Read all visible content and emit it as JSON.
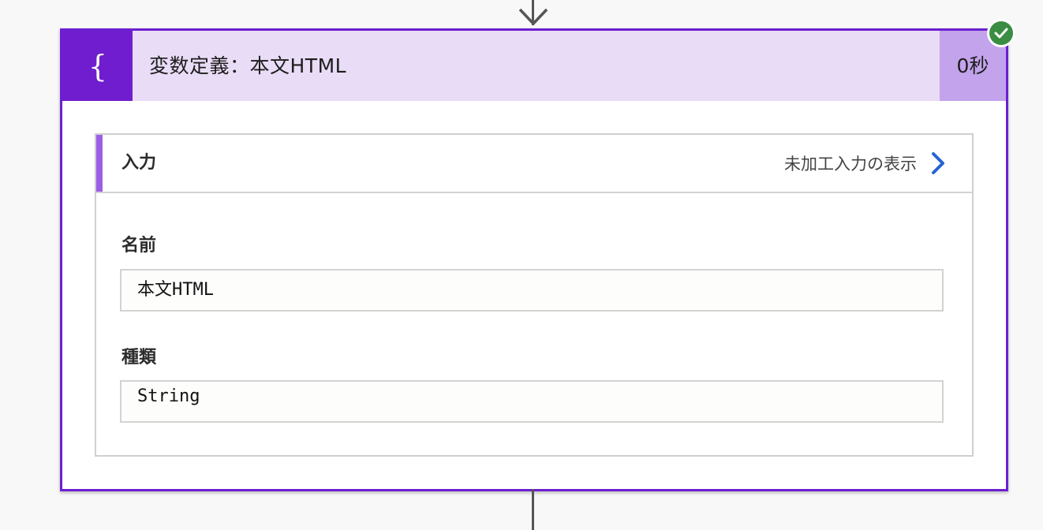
{
  "action": {
    "title": "変数定義：本文HTML",
    "duration": "0秒",
    "icon": "variable-braces-icon",
    "status": "succeeded",
    "colors": {
      "accent": "#6f1dce",
      "header_bg": "#e9dcf6",
      "duration_bg": "#c3a3ec",
      "success": "#3a8d42"
    }
  },
  "inputs": {
    "title": "入力",
    "raw_link_label": "未加工入力の表示",
    "fields": [
      {
        "label": "名前",
        "value": "本文HTML"
      },
      {
        "label": "種類",
        "value": "String"
      }
    ]
  }
}
